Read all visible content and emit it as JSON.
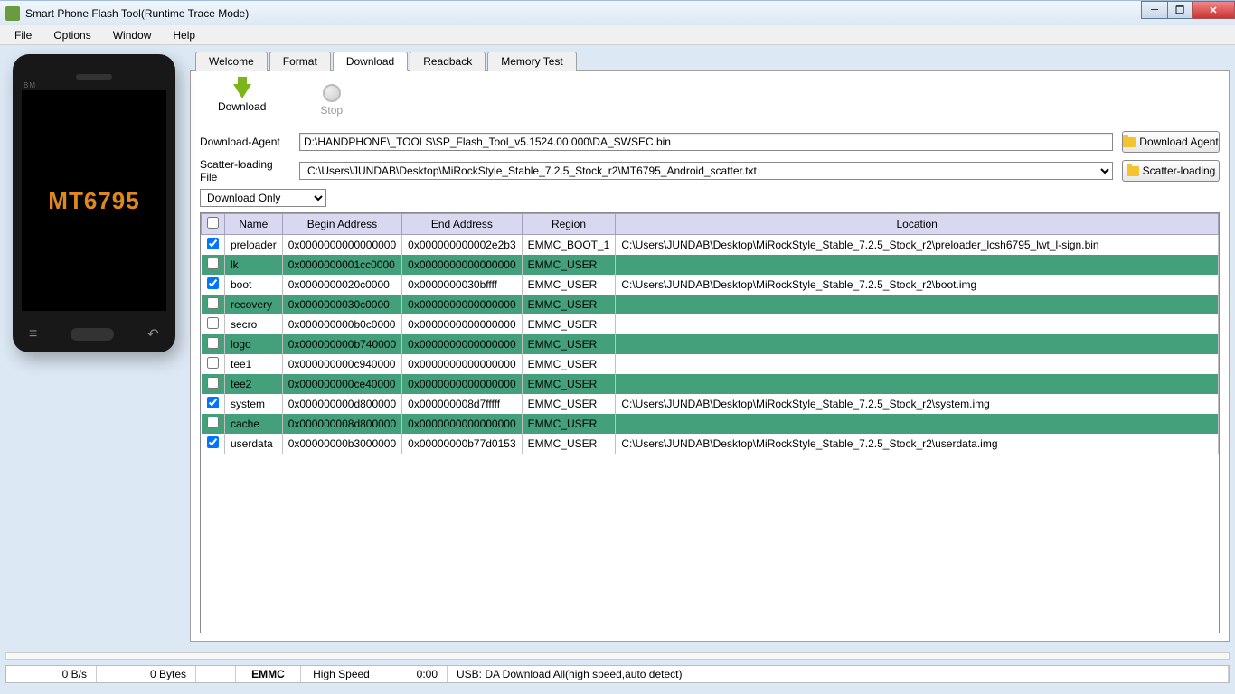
{
  "window": {
    "title": "Smart Phone Flash Tool(Runtime Trace Mode)"
  },
  "menu": {
    "file": "File",
    "options": "Options",
    "window": "Window",
    "help": "Help"
  },
  "phone": {
    "brand": "BM",
    "chip": "MT6795"
  },
  "tabs": {
    "welcome": "Welcome",
    "format": "Format",
    "download": "Download",
    "readback": "Readback",
    "memory_test": "Memory Test"
  },
  "toolbar": {
    "download": "Download",
    "stop": "Stop"
  },
  "form": {
    "da_label": "Download-Agent",
    "da_value": "D:\\HANDPHONE\\_TOOLS\\SP_Flash_Tool_v5.1524.00.000\\DA_SWSEC.bin",
    "da_btn": "Download Agent",
    "scatter_label": "Scatter-loading File",
    "scatter_value": "C:\\Users\\JUNDAB\\Desktop\\MiRockStyle_Stable_7.2.5_Stock_r2\\MT6795_Android_scatter.txt",
    "scatter_btn": "Scatter-loading",
    "mode": "Download Only"
  },
  "table": {
    "headers": {
      "name": "Name",
      "begin": "Begin Address",
      "end": "End Address",
      "region": "Region",
      "location": "Location"
    },
    "rows": [
      {
        "chk": true,
        "green": false,
        "name": "preloader",
        "begin": "0x0000000000000000",
        "end": "0x000000000002e2b3",
        "region": "EMMC_BOOT_1",
        "loc": "C:\\Users\\JUNDAB\\Desktop\\MiRockStyle_Stable_7.2.5_Stock_r2\\preloader_lcsh6795_lwt_l-sign.bin"
      },
      {
        "chk": false,
        "green": true,
        "name": "lk",
        "begin": "0x0000000001cc0000",
        "end": "0x0000000000000000",
        "region": "EMMC_USER",
        "loc": ""
      },
      {
        "chk": true,
        "green": false,
        "name": "boot",
        "begin": "0x0000000020c0000",
        "end": "0x0000000030bffff",
        "region": "EMMC_USER",
        "loc": "C:\\Users\\JUNDAB\\Desktop\\MiRockStyle_Stable_7.2.5_Stock_r2\\boot.img"
      },
      {
        "chk": false,
        "green": true,
        "name": "recovery",
        "begin": "0x0000000030c0000",
        "end": "0x0000000000000000",
        "region": "EMMC_USER",
        "loc": ""
      },
      {
        "chk": false,
        "green": false,
        "name": "secro",
        "begin": "0x000000000b0c0000",
        "end": "0x0000000000000000",
        "region": "EMMC_USER",
        "loc": ""
      },
      {
        "chk": false,
        "green": true,
        "name": "logo",
        "begin": "0x000000000b740000",
        "end": "0x0000000000000000",
        "region": "EMMC_USER",
        "loc": ""
      },
      {
        "chk": false,
        "green": false,
        "name": "tee1",
        "begin": "0x000000000c940000",
        "end": "0x0000000000000000",
        "region": "EMMC_USER",
        "loc": ""
      },
      {
        "chk": false,
        "green": true,
        "name": "tee2",
        "begin": "0x000000000ce40000",
        "end": "0x0000000000000000",
        "region": "EMMC_USER",
        "loc": ""
      },
      {
        "chk": true,
        "green": false,
        "name": "system",
        "begin": "0x000000000d800000",
        "end": "0x000000008d7fffff",
        "region": "EMMC_USER",
        "loc": "C:\\Users\\JUNDAB\\Desktop\\MiRockStyle_Stable_7.2.5_Stock_r2\\system.img"
      },
      {
        "chk": false,
        "green": true,
        "name": "cache",
        "begin": "0x000000008d800000",
        "end": "0x0000000000000000",
        "region": "EMMC_USER",
        "loc": ""
      },
      {
        "chk": true,
        "green": false,
        "name": "userdata",
        "begin": "0x00000000b3000000",
        "end": "0x00000000b77d0153",
        "region": "EMMC_USER",
        "loc": "C:\\Users\\JUNDAB\\Desktop\\MiRockStyle_Stable_7.2.5_Stock_r2\\userdata.img"
      }
    ]
  },
  "status": {
    "speed": "0 B/s",
    "bytes": "0 Bytes",
    "storage": "EMMC",
    "mode": "High Speed",
    "time": "0:00",
    "usb": "USB: DA Download All(high speed,auto detect)"
  }
}
